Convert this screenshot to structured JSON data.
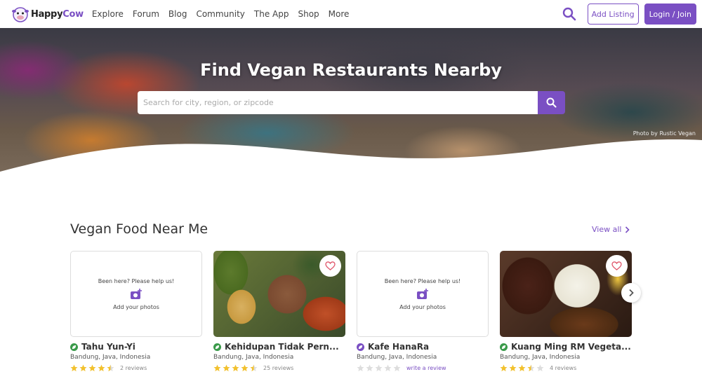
{
  "brand": {
    "name_part1": "Happy",
    "name_part2": "Cow",
    "accent": "#7a4fc3"
  },
  "nav": {
    "items": [
      "Explore",
      "Forum",
      "Blog",
      "Community",
      "The App",
      "Shop",
      "More"
    ]
  },
  "header": {
    "search_icon": "search-icon",
    "add_listing": "Add Listing",
    "login": "Login / Join"
  },
  "hero": {
    "title": "Find Vegan Restaurants Nearby",
    "search_placeholder": "Search for city, region, or zipcode",
    "search_value": "",
    "photo_credit": "Photo by Rustic Vegan"
  },
  "section": {
    "title": "Vegan Food Near Me",
    "view_all": "View all"
  },
  "cards": [
    {
      "name": "Tahu Yun-Yi",
      "location": "Bandung, Java, Indonesia",
      "rating": 4.5,
      "reviews": "2 reviews",
      "has_photo": false,
      "empty_prompt": "Been here? Please help us!",
      "empty_action": "Add your photos",
      "badge_color": "#3a9a4a"
    },
    {
      "name": "Kehidupan Tidak Pern...",
      "location": "Bandung, Java, Indonesia",
      "rating": 4.5,
      "reviews": "25 reviews",
      "has_photo": true,
      "badge_color": "#3a9a4a"
    },
    {
      "name": "Kafe HanaRa",
      "location": "Bandung, Java, Indonesia",
      "rating": 0,
      "reviews": "write a review",
      "has_photo": false,
      "empty_prompt": "Been here? Please help us!",
      "empty_action": "Add your photos",
      "badge_color": "#7a4fc3"
    },
    {
      "name": "Kuang Ming RM Vegeta...",
      "location": "Bandung, Java, Indonesia",
      "rating": 3.5,
      "reviews": "4 reviews",
      "has_photo": true,
      "badge_color": "#3a9a4a"
    }
  ],
  "colors": {
    "star_filled": "#f2c12e",
    "star_empty": "#dddddd",
    "hero_button": "#7a4fc3"
  }
}
